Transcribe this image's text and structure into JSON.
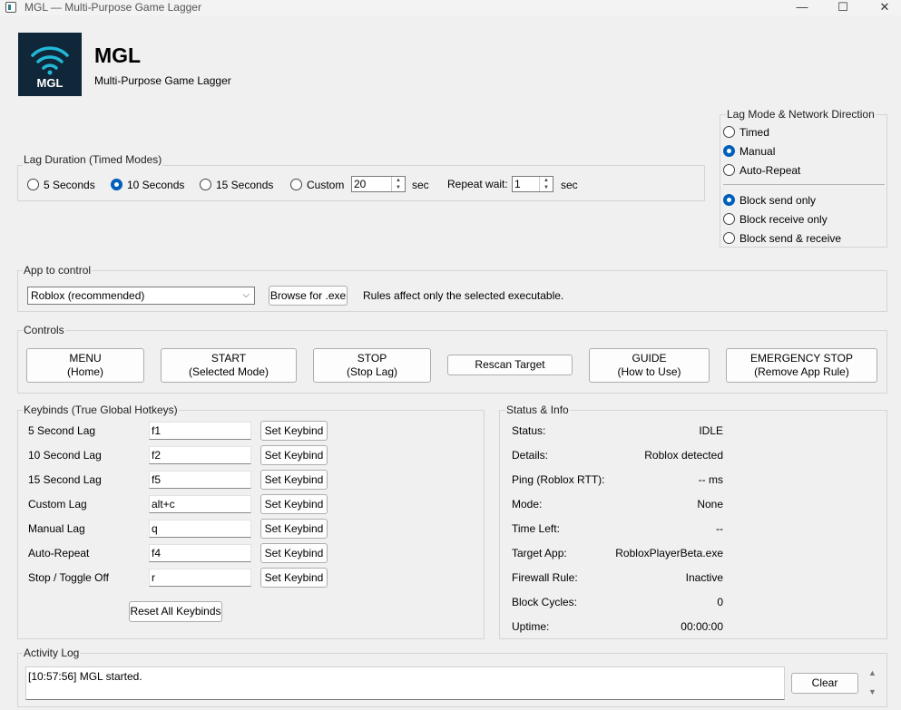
{
  "window": {
    "title": "MGL — Multi-Purpose Game Lagger",
    "minimize_glyph": "—",
    "maximize_glyph": "☐",
    "close_glyph": "✕"
  },
  "header": {
    "logo_text": "MGL",
    "app_name": "MGL",
    "subtitle": "Multi-Purpose Game Lagger",
    "brand_color": "#0f2738",
    "accent_color": "#22b8d8"
  },
  "lag_duration": {
    "title": "Lag Duration (Timed Modes)",
    "options": [
      "5 Seconds",
      "10 Seconds",
      "15 Seconds",
      "Custom"
    ],
    "selected": "10 Seconds",
    "custom_value": "20",
    "custom_unit": "sec",
    "repeat_label": "Repeat wait:",
    "repeat_value": "1",
    "repeat_unit": "sec"
  },
  "lag_mode": {
    "title": "Lag Mode & Network Direction",
    "modes": [
      "Timed",
      "Manual",
      "Auto-Repeat"
    ],
    "selected_mode": "Manual",
    "directions": [
      "Block send only",
      "Block receive only",
      "Block send & receive"
    ],
    "selected_direction": "Block send only"
  },
  "app_control": {
    "title": "App to control",
    "selected_app": "Roblox (recommended)",
    "browse_label": "Browse for .exe",
    "note": "Rules affect only the selected executable."
  },
  "controls": {
    "title": "Controls",
    "buttons": [
      {
        "line1": "MENU",
        "line2": "(Home)"
      },
      {
        "line1": "START",
        "line2": "(Selected Mode)"
      },
      {
        "line1": "STOP",
        "line2": "(Stop Lag)"
      },
      {
        "line1": "Rescan Target",
        "line2": ""
      },
      {
        "line1": "GUIDE",
        "line2": "(How to Use)"
      },
      {
        "line1": "EMERGENCY STOP",
        "line2": "(Remove App Rule)"
      }
    ]
  },
  "keybinds": {
    "title": "Keybinds (True Global Hotkeys)",
    "set_label": "Set Keybind",
    "reset_label": "Reset All Keybinds",
    "rows": [
      {
        "label": "5 Second Lag",
        "key": "f1"
      },
      {
        "label": "10 Second Lag",
        "key": "f2"
      },
      {
        "label": "15 Second Lag",
        "key": "f5"
      },
      {
        "label": "Custom Lag",
        "key": "alt+c"
      },
      {
        "label": "Manual Lag",
        "key": "q"
      },
      {
        "label": "Auto-Repeat",
        "key": "f4"
      },
      {
        "label": "Stop / Toggle Off",
        "key": "r"
      }
    ]
  },
  "status": {
    "title": "Status & Info",
    "rows": [
      {
        "label": "Status:",
        "value": "IDLE"
      },
      {
        "label": "Details:",
        "value": "Roblox detected"
      },
      {
        "label": "Ping (Roblox RTT):",
        "value": "-- ms"
      },
      {
        "label": "Mode:",
        "value": "None"
      },
      {
        "label": "Time Left:",
        "value": "--"
      },
      {
        "label": "Target App:",
        "value": "RobloxPlayerBeta.exe"
      },
      {
        "label": "Firewall Rule:",
        "value": "Inactive"
      },
      {
        "label": "Block Cycles:",
        "value": "0"
      },
      {
        "label": "Uptime:",
        "value": "00:00:00"
      }
    ]
  },
  "activity_log": {
    "title": "Activity Log",
    "entries": [
      "[10:57:56] MGL started."
    ],
    "clear_label": "Clear"
  }
}
